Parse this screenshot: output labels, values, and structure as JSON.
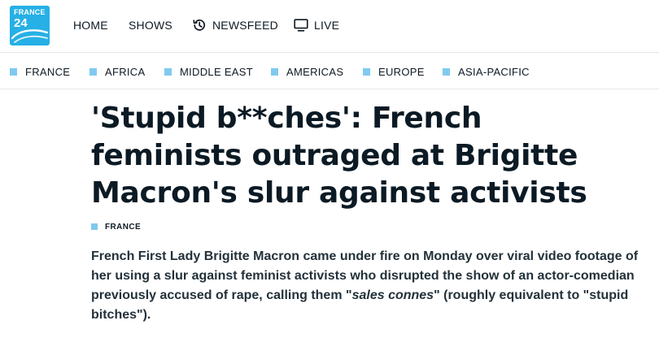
{
  "brand": {
    "logo_line1": "FRANCE",
    "logo_line2": "24",
    "accent_color": "#26b0e5",
    "section_marker_color": "#7fcaef"
  },
  "main_nav": [
    {
      "label": "HOME",
      "icon": null
    },
    {
      "label": "SHOWS",
      "icon": null
    },
    {
      "label": "NEWSFEED",
      "icon": "history-clock-icon"
    },
    {
      "label": "LIVE",
      "icon": "tv-monitor-icon"
    }
  ],
  "sections": [
    {
      "label": "FRANCE"
    },
    {
      "label": "AFRICA"
    },
    {
      "label": "MIDDLE EAST"
    },
    {
      "label": "AMERICAS"
    },
    {
      "label": "EUROPE"
    },
    {
      "label": "ASIA-PACIFIC"
    }
  ],
  "article": {
    "headline": "'Stupid b**ches': French feminists outraged at Brigitte Macron's slur against activists",
    "category_tag": "FRANCE",
    "lede_before": "French First Lady Brigitte Macron came under fire on Monday over viral video footage of her using a slur against feminist activists who disrupted the show of an actor-comedian previously accused of rape, calling them \"",
    "lede_emphasis": "sales connes",
    "lede_after": "\" (roughly equivalent to \"stupid bitches\")."
  }
}
